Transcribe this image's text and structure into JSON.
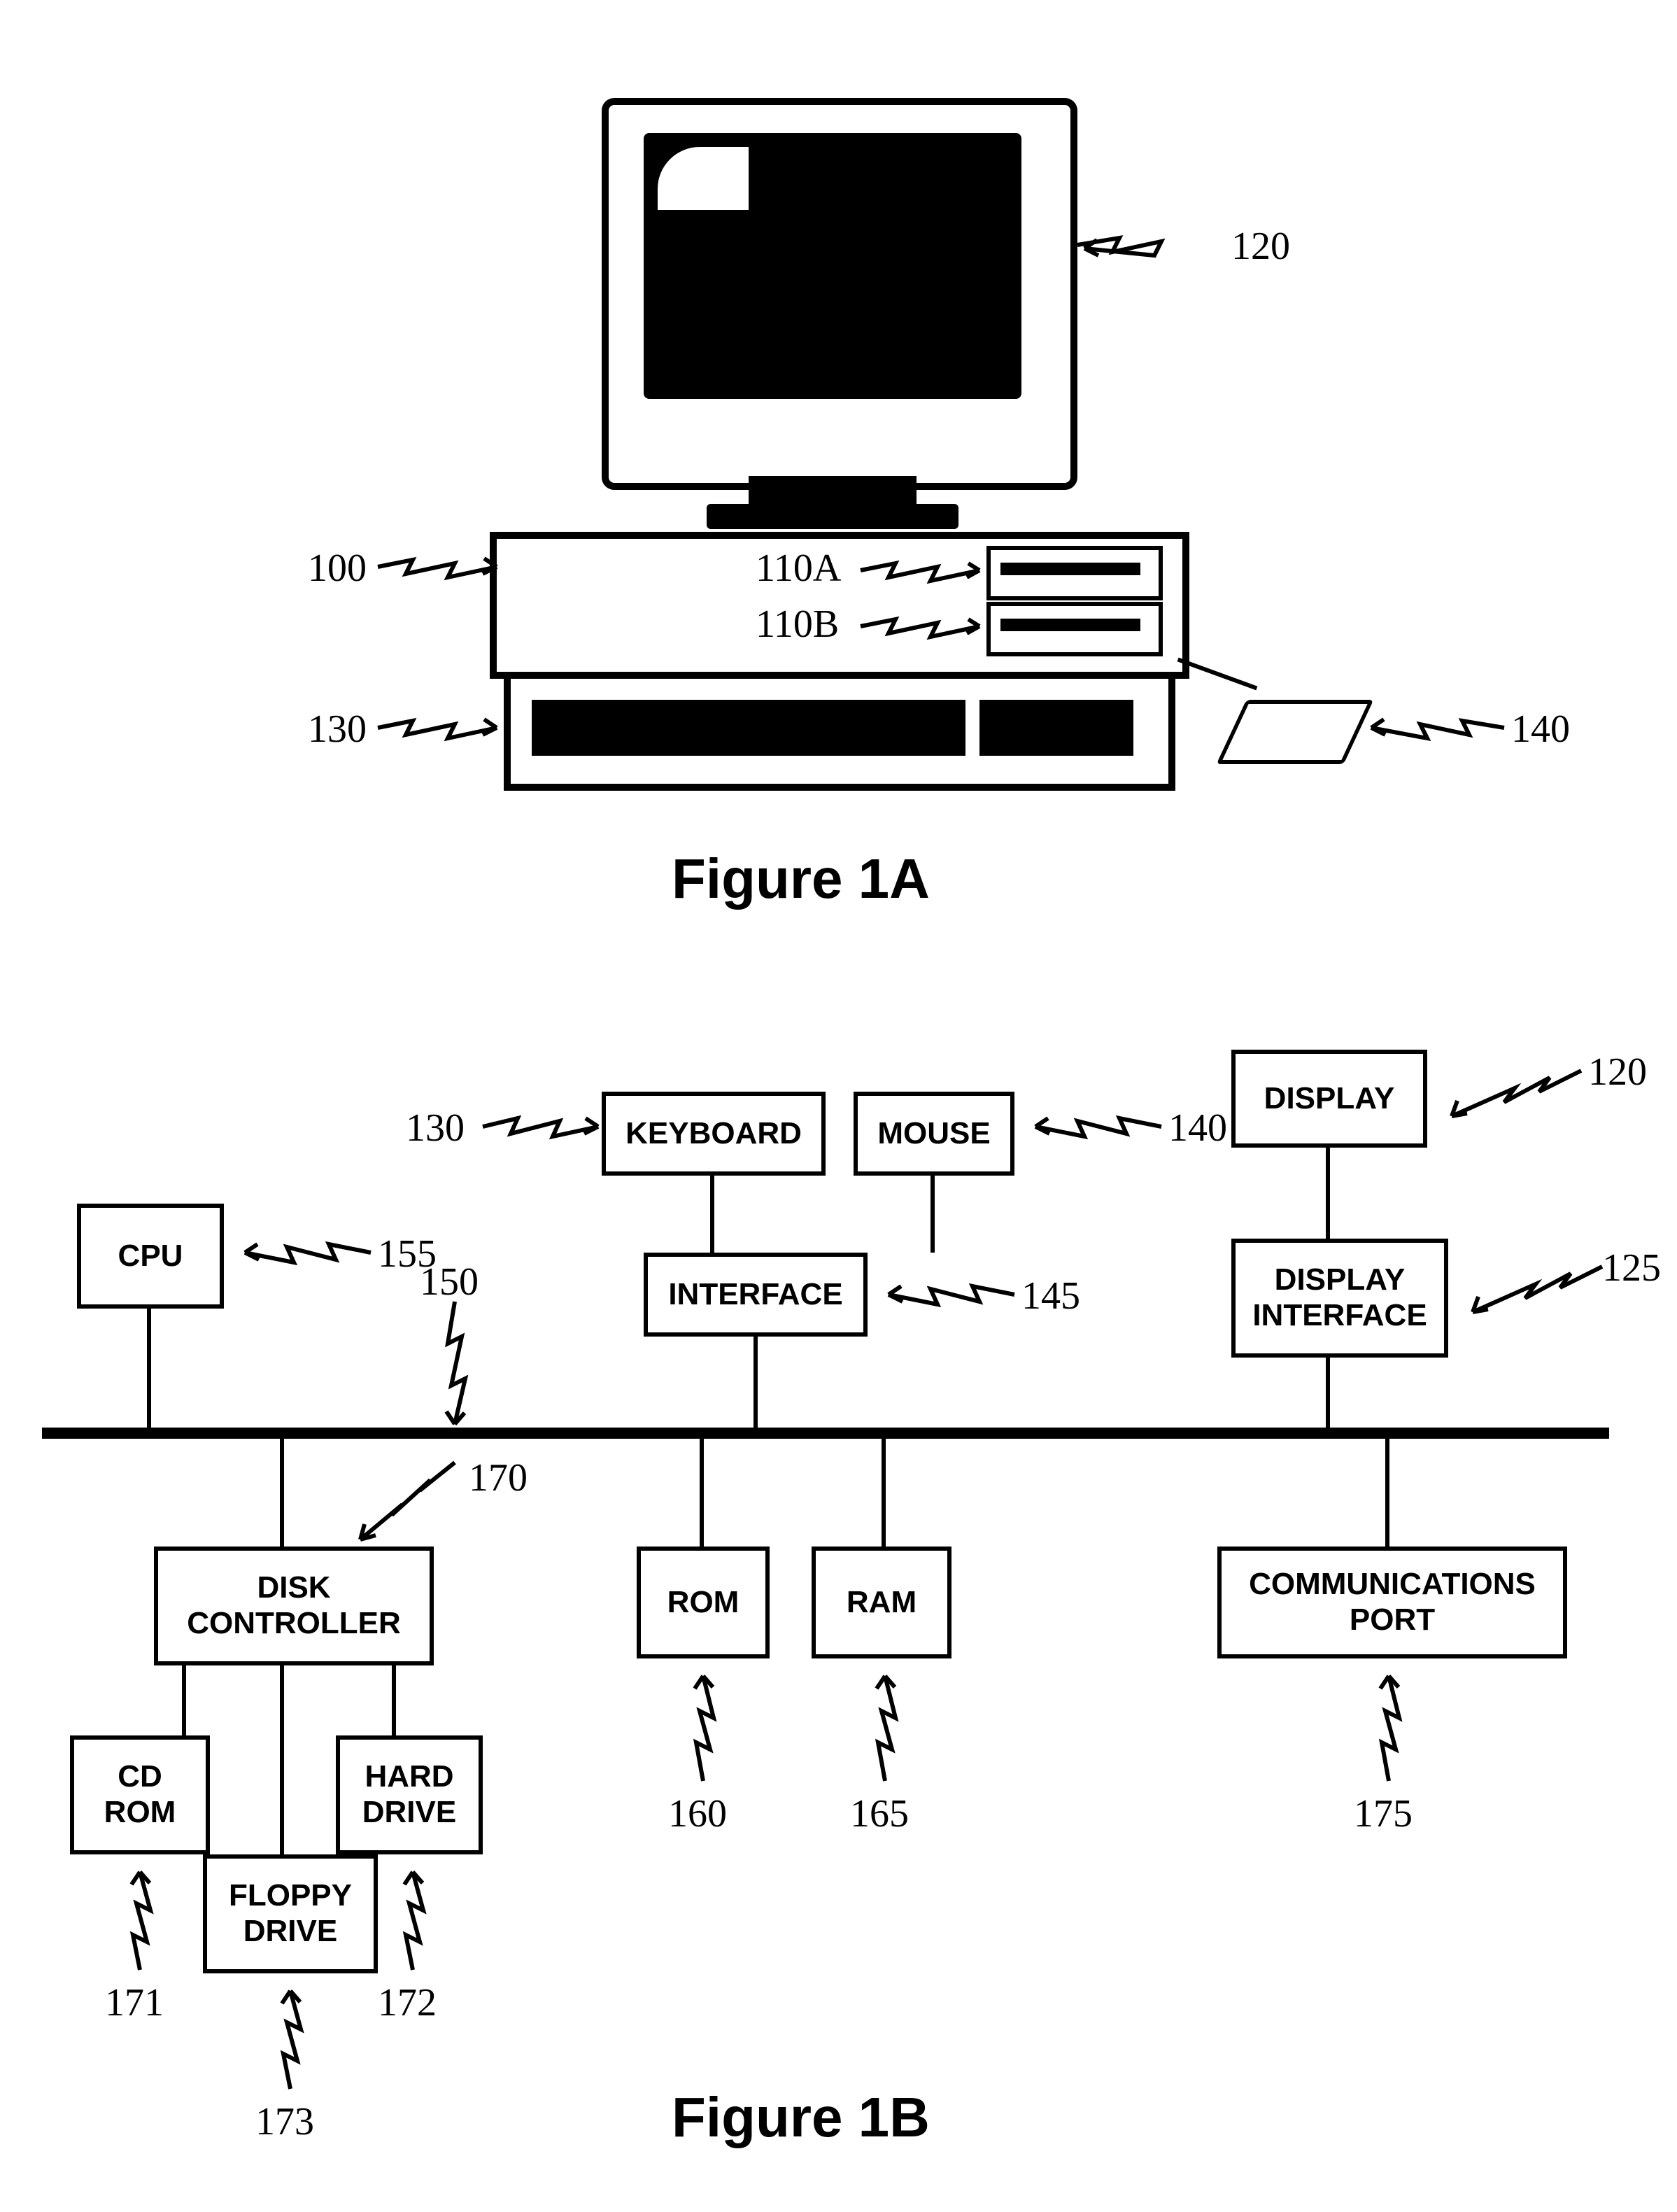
{
  "figA": {
    "title": "Figure 1A"
  },
  "figB": {
    "title": "Figure 1B"
  },
  "refsA": {
    "r100": "100",
    "r110A": "110A",
    "r110B": "110B",
    "r120": "120",
    "r130": "130",
    "r140": "140"
  },
  "boxesB": {
    "cpu": "CPU",
    "keyboard": "KEYBOARD",
    "mouse": "MOUSE",
    "display": "DISPLAY",
    "interface": "INTERFACE",
    "display_interface": "DISPLAY INTERFACE",
    "disk_controller": "DISK CONTROLLER",
    "rom": "ROM",
    "ram": "RAM",
    "comm_port": "COMMUNICATIONS PORT",
    "cd_rom": "CD ROM",
    "hard_drive": "HARD DRIVE",
    "floppy_drive": "FLOPPY DRIVE"
  },
  "refsB": {
    "r120": "120",
    "r125": "125",
    "r130": "130",
    "r140": "140",
    "r145": "145",
    "r150": "150",
    "r155": "155",
    "r160": "160",
    "r165": "165",
    "r170": "170",
    "r171": "171",
    "r172": "172",
    "r173": "173",
    "r175": "175"
  }
}
